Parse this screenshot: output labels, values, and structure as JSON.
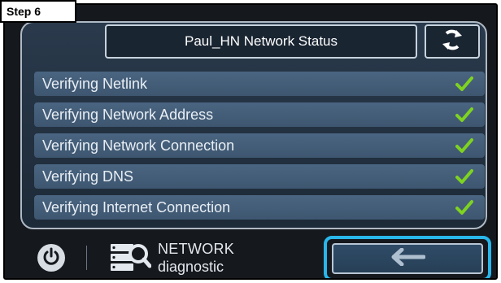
{
  "step_label": "Step 6",
  "header": {
    "title": "Paul_HN Network Status",
    "refresh_icon": "refresh-icon"
  },
  "checks": [
    {
      "label": "Verifying Netlink",
      "status": "ok"
    },
    {
      "label": "Verifying Network Address",
      "status": "ok"
    },
    {
      "label": "Verifying Network Connection",
      "status": "ok"
    },
    {
      "label": "Verifying DNS",
      "status": "ok"
    },
    {
      "label": "Verifying Internet Connection",
      "status": "ok"
    }
  ],
  "footer": {
    "power_icon": "power-icon",
    "network_icon": "network-search-icon",
    "network_label_1": "NETWORK",
    "network_label_2": "diagnostic",
    "back_icon": "back-arrow-icon"
  },
  "colors": {
    "check_green": "#7ed321",
    "highlight_blue": "#29b6ea",
    "row_bg": "#45607b"
  }
}
